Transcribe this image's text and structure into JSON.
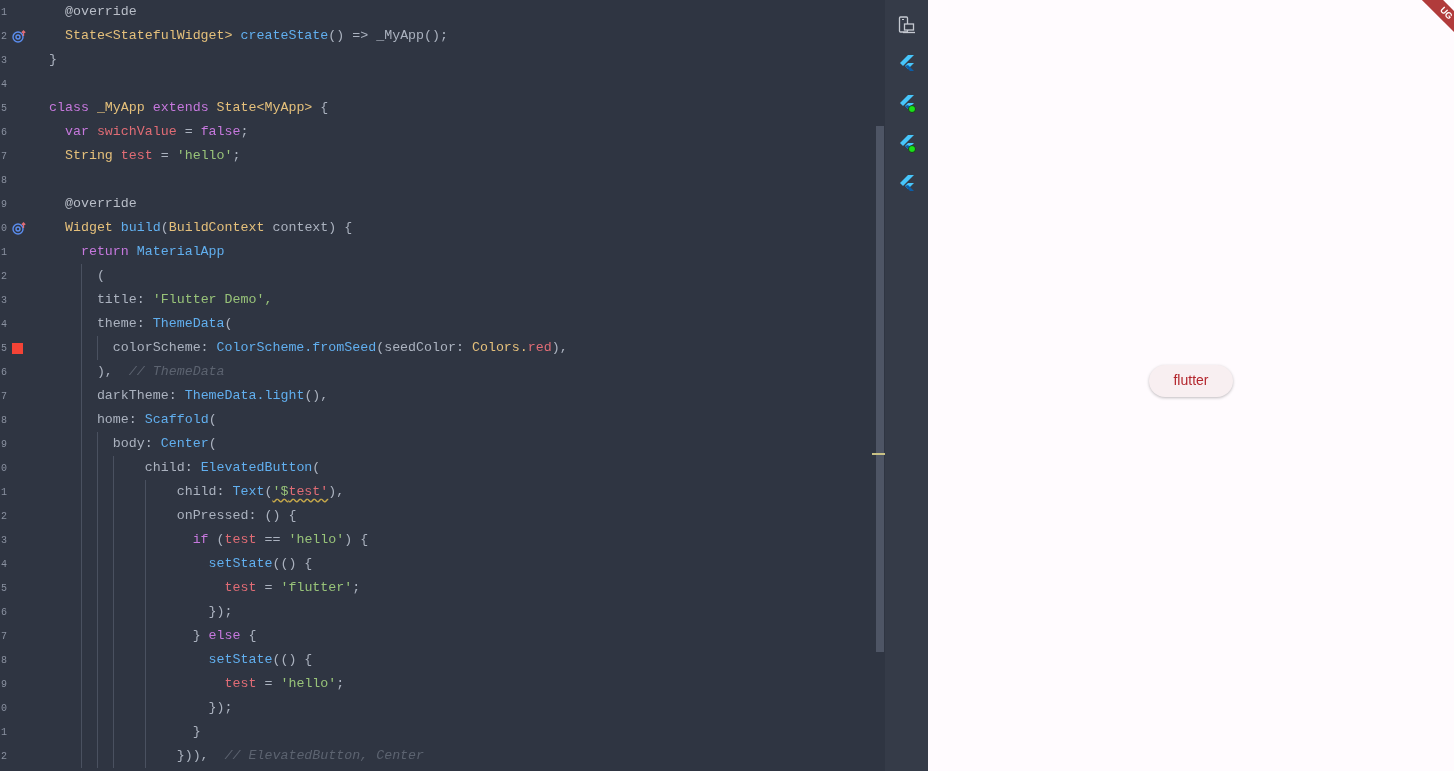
{
  "editor": {
    "lines": [
      {
        "number": "1",
        "tokens": [
          {
            "text": "  @override",
            "color": "#b9bec8"
          }
        ]
      },
      {
        "number": "2",
        "gutter": {
          "kind": "override"
        },
        "tokens": [
          {
            "text": "  State<StatefulWidget> ",
            "color": "#e5c07b"
          },
          {
            "text": "createState",
            "color": "#61afef"
          },
          {
            "text": "() => _MyApp();",
            "color": "#abb2bf"
          }
        ]
      },
      {
        "number": "3",
        "tokens": [
          {
            "text": "}",
            "color": "#abb2bf"
          }
        ]
      },
      {
        "number": "4"
      },
      {
        "number": "5",
        "tokens": [
          {
            "text": "class ",
            "color": "#c678dd"
          },
          {
            "text": "_MyApp ",
            "color": "#e5c07b"
          },
          {
            "text": "extends ",
            "color": "#c678dd"
          },
          {
            "text": "State<MyApp>",
            "color": "#e5c07b"
          },
          {
            "text": " {",
            "color": "#abb2bf"
          }
        ]
      },
      {
        "number": "6",
        "tokens": [
          {
            "text": "  var ",
            "color": "#c678dd"
          },
          {
            "text": "swichValue",
            "color": "#e06c75"
          },
          {
            "text": " = ",
            "color": "#abb2bf"
          },
          {
            "text": "false",
            "color": "#c678dd"
          },
          {
            "text": ";",
            "color": "#abb2bf"
          }
        ]
      },
      {
        "number": "7",
        "tokens": [
          {
            "text": "  String ",
            "color": "#e5c07b"
          },
          {
            "text": "test",
            "color": "#e06c75"
          },
          {
            "text": " = ",
            "color": "#abb2bf"
          },
          {
            "text": "'hello'",
            "color": "#98c379"
          },
          {
            "text": ";",
            "color": "#abb2bf"
          }
        ]
      },
      {
        "number": "8"
      },
      {
        "number": "9",
        "tokens": [
          {
            "text": "  @override",
            "color": "#b9bec8"
          }
        ]
      },
      {
        "number": "0",
        "gutter": {
          "kind": "override"
        },
        "tokens": [
          {
            "text": "  Widget ",
            "color": "#e5c07b"
          },
          {
            "text": "build",
            "color": "#61afef"
          },
          {
            "text": "(",
            "color": "#abb2bf"
          },
          {
            "text": "BuildContext",
            "color": "#e5c07b"
          },
          {
            "text": " context) {",
            "color": "#abb2bf"
          }
        ]
      },
      {
        "number": "1",
        "tokens": [
          {
            "text": "    return ",
            "color": "#c678dd"
          },
          {
            "text": "MaterialApp",
            "color": "#61afef"
          }
        ]
      },
      {
        "number": "2",
        "tokens": [
          {
            "text": "      ("
          }
        ]
      },
      {
        "number": "3",
        "tokens": [
          {
            "text": "      title: ",
            "color": "#abb2bf"
          },
          {
            "text": "'Flutter Demo',",
            "color": "#98c379"
          }
        ]
      },
      {
        "number": "4",
        "tokens": [
          {
            "text": "      theme: ",
            "color": "#abb2bf"
          },
          {
            "text": "ThemeData",
            "color": "#61afef"
          },
          {
            "text": "(",
            "color": "#abb2bf"
          }
        ]
      },
      {
        "number": "5",
        "gutter": {
          "kind": "color"
        },
        "tokens": [
          {
            "text": "        colorScheme: ",
            "color": "#abb2bf"
          },
          {
            "text": "ColorScheme.fromSeed",
            "color": "#61afef"
          },
          {
            "text": "(seedColor: ",
            "color": "#abb2bf"
          },
          {
            "text": "Colors.",
            "color": "#e5c07b"
          },
          {
            "text": "red",
            "color": "#e06c75"
          },
          {
            "text": "),",
            "color": "#abb2bf"
          }
        ]
      },
      {
        "number": "6",
        "tokens": [
          {
            "text": "      ),  ",
            "color": "#abb2bf"
          },
          {
            "text": "// ThemeData",
            "color": "#5c6370",
            "italic": true
          }
        ]
      },
      {
        "number": "7",
        "tokens": [
          {
            "text": "      darkTheme: ",
            "color": "#abb2bf"
          },
          {
            "text": "ThemeData.light",
            "color": "#61afef"
          },
          {
            "text": "(),",
            "color": "#abb2bf"
          }
        ]
      },
      {
        "number": "8",
        "tokens": [
          {
            "text": "      home: ",
            "color": "#abb2bf"
          },
          {
            "text": "Scaffold",
            "color": "#61afef"
          },
          {
            "text": "(",
            "color": "#abb2bf"
          }
        ]
      },
      {
        "number": "9",
        "tokens": [
          {
            "text": "        body: ",
            "color": "#abb2bf"
          },
          {
            "text": "Center",
            "color": "#61afef"
          },
          {
            "text": "(",
            "color": "#abb2bf"
          }
        ]
      },
      {
        "number": "0",
        "tokens": [
          {
            "text": "            child: ",
            "color": "#abb2bf"
          },
          {
            "text": "ElevatedButton",
            "color": "#61afef"
          },
          {
            "text": "(",
            "color": "#abb2bf"
          }
        ]
      },
      {
        "number": "1",
        "tokens": [
          {
            "text": "                child: ",
            "color": "#abb2bf"
          },
          {
            "text": "Text",
            "color": "#61afef"
          },
          {
            "text": "(",
            "color": "#abb2bf"
          },
          {
            "text": "'$",
            "color": "#98c379",
            "warning": true
          },
          {
            "text": "test'",
            "color": "#e06c75",
            "warning": true
          },
          {
            "text": "),",
            "color": "#abb2bf"
          }
        ]
      },
      {
        "number": "2",
        "tokens": [
          {
            "text": "                onPressed: () {",
            "color": "#abb2bf"
          }
        ]
      },
      {
        "number": "3",
        "tokens": [
          {
            "text": "                  if",
            "color": "#c678dd"
          },
          {
            "text": " (",
            "color": "#abb2bf"
          },
          {
            "text": "test",
            "color": "#e06c75"
          },
          {
            "text": " == ",
            "color": "#abb2bf"
          },
          {
            "text": "'hello'",
            "color": "#98c379"
          },
          {
            "text": ") {",
            "color": "#abb2bf"
          }
        ]
      },
      {
        "number": "4",
        "tokens": [
          {
            "text": "                    setState",
            "color": "#61afef"
          },
          {
            "text": "(() {",
            "color": "#abb2bf"
          }
        ]
      },
      {
        "number": "5",
        "tokens": [
          {
            "text": "                      test",
            "color": "#e06c75"
          },
          {
            "text": " = ",
            "color": "#abb2bf"
          },
          {
            "text": "'flutter'",
            "color": "#98c379"
          },
          {
            "text": ";",
            "color": "#abb2bf"
          }
        ]
      },
      {
        "number": "6",
        "tokens": [
          {
            "text": "                    });",
            "color": "#abb2bf"
          }
        ]
      },
      {
        "number": "7",
        "tokens": [
          {
            "text": "                  } ",
            "color": "#abb2bf"
          },
          {
            "text": "else",
            "color": "#c678dd"
          },
          {
            "text": " {",
            "color": "#abb2bf"
          }
        ]
      },
      {
        "number": "8",
        "tokens": [
          {
            "text": "                    setState",
            "color": "#61afef"
          },
          {
            "text": "(() {",
            "color": "#abb2bf"
          }
        ]
      },
      {
        "number": "9",
        "tokens": [
          {
            "text": "                      test",
            "color": "#e06c75"
          },
          {
            "text": " = ",
            "color": "#abb2bf"
          },
          {
            "text": "'hello'",
            "color": "#98c379"
          },
          {
            "text": ";",
            "color": "#abb2bf"
          }
        ]
      },
      {
        "number": "0",
        "tokens": [
          {
            "text": "                    });",
            "color": "#abb2bf"
          }
        ]
      },
      {
        "number": "1",
        "tokens": [
          {
            "text": "                  }",
            "color": "#abb2bf"
          }
        ]
      },
      {
        "number": "2",
        "tokens": [
          {
            "text": "                })),  ",
            "color": "#abb2bf"
          },
          {
            "text": "// ElevatedButton, Center",
            "color": "#5c6370",
            "italic": true
          }
        ]
      }
    ]
  },
  "side_toolbar": [
    {
      "kind": "device"
    },
    {
      "kind": "flutter",
      "running": false
    },
    {
      "kind": "flutter",
      "running": true
    },
    {
      "kind": "flutter",
      "running": true
    },
    {
      "kind": "flutter",
      "running": false
    }
  ],
  "preview": {
    "button": "flutter",
    "debug_banner": "UG"
  }
}
